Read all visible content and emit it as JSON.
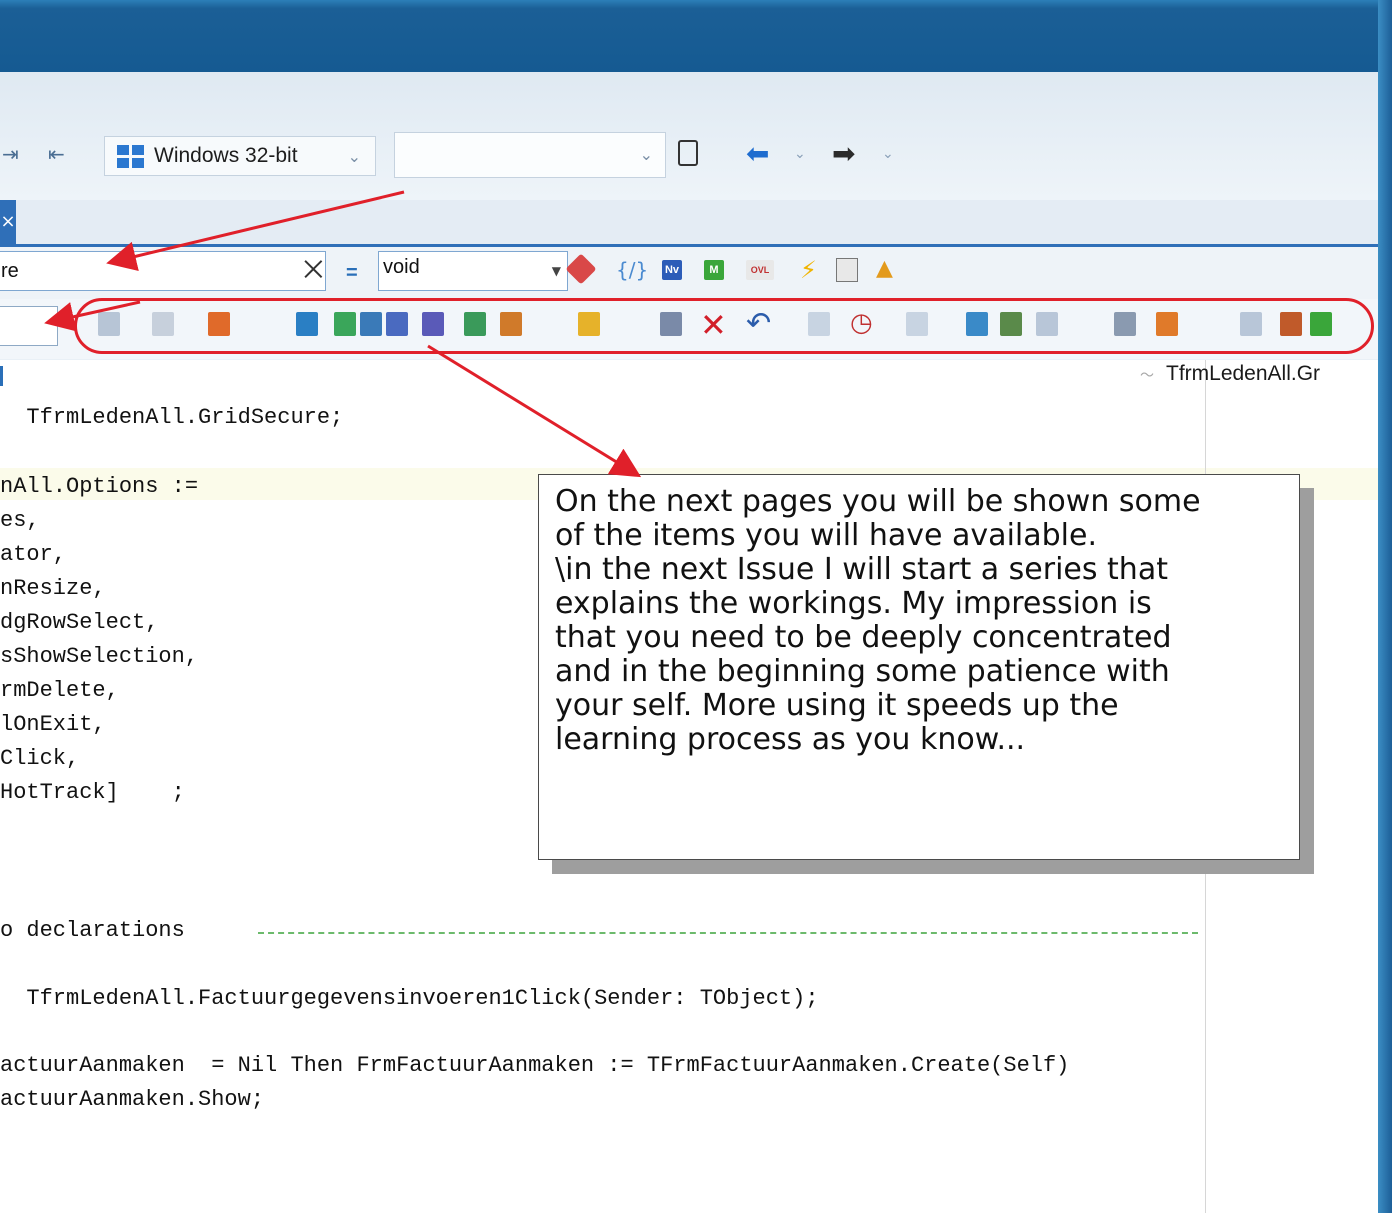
{
  "window": {
    "platform_label": "Windows 32-bit",
    "config_value": ""
  },
  "editor_nav": {
    "class_value": "re",
    "method_value": "void",
    "search_value": ""
  },
  "structure_path": "TfrmLedenAll.Gr",
  "code": {
    "lines": [
      {
        "text": "  TfrmLedenAll.GridSecure;"
      },
      {
        "text": "nAll.Options :="
      },
      {
        "text": "es,"
      },
      {
        "text": "ator,"
      },
      {
        "text": "nResize,"
      },
      {
        "text": "dgRowSelect,"
      },
      {
        "text": "sShowSelection,"
      },
      {
        "text": "rmDelete,"
      },
      {
        "text": "lOnExit,"
      },
      {
        "text": "Click,"
      },
      {
        "text": "HotTrack]    ;"
      },
      {
        "text": "o declarations"
      },
      {
        "text": "  TfrmLedenAll.Factuurgegevensinvoeren1Click(Sender: TObject);"
      },
      {
        "text": "actuurAanmaken  = Nil Then FrmFactuurAanmaken := TFrmFactuurAanmaken.Create(Self)"
      },
      {
        "text": "actuurAanmaken.Show;"
      }
    ]
  },
  "callout": {
    "lines": [
      "On the next pages you will be shown some",
      "of the items you will have available.",
      "\\in the next Issue I will start a series that",
      "explains the workings. My impression is",
      "that you need to be deeply concentrated",
      "and in the beginning some patience with",
      "your self. More using it speeds up the",
      "learning process as you know..."
    ]
  },
  "icons": {
    "nv": "Nv",
    "m": "M",
    "ovl": "OVL"
  },
  "colors": {
    "annotation_red": "#e0202a",
    "title_blue": "#155a92",
    "windows_blue": "#2b78d0"
  }
}
